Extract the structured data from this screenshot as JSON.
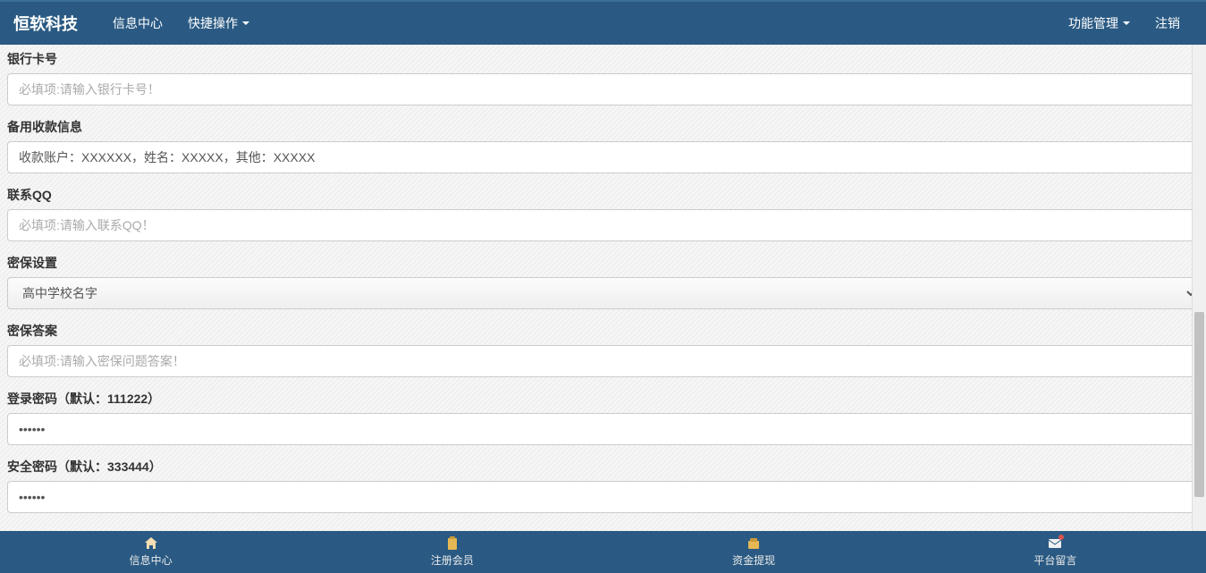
{
  "topbar": {
    "brand": "恒软科技",
    "left": [
      {
        "label": "信息中心",
        "has_caret": false
      },
      {
        "label": "快捷操作",
        "has_caret": true
      }
    ],
    "right": [
      {
        "label": "功能管理",
        "has_caret": true
      },
      {
        "label": "注销",
        "has_caret": false
      }
    ]
  },
  "form": {
    "bank_card": {
      "label": "银行卡号",
      "placeholder": "必填项:请输入银行卡号！",
      "value": ""
    },
    "backup_pay": {
      "label": "备用收款信息",
      "placeholder": "",
      "value": "收款账户：XXXXXX，姓名：XXXXX，其他：XXXXX"
    },
    "qq": {
      "label": "联系QQ",
      "placeholder": "必填项:请输入联系QQ！",
      "value": ""
    },
    "security_q": {
      "label": "密保设置",
      "selected": "高中学校名字"
    },
    "security_a": {
      "label": "密保答案",
      "placeholder": "必填项:请输入密保问题答案！",
      "value": ""
    },
    "login_pwd": {
      "label": "登录密码（默认：111222）",
      "value": "••••••"
    },
    "safe_pwd": {
      "label": "安全密码（默认：333444）",
      "value": "••••••"
    }
  },
  "bottombar": [
    {
      "icon": "home",
      "label": "信息中心"
    },
    {
      "icon": "clipboard",
      "label": "注册会员"
    },
    {
      "icon": "wallet",
      "label": "资金提现"
    },
    {
      "icon": "mail",
      "label": "平台留言",
      "badge": true
    }
  ]
}
